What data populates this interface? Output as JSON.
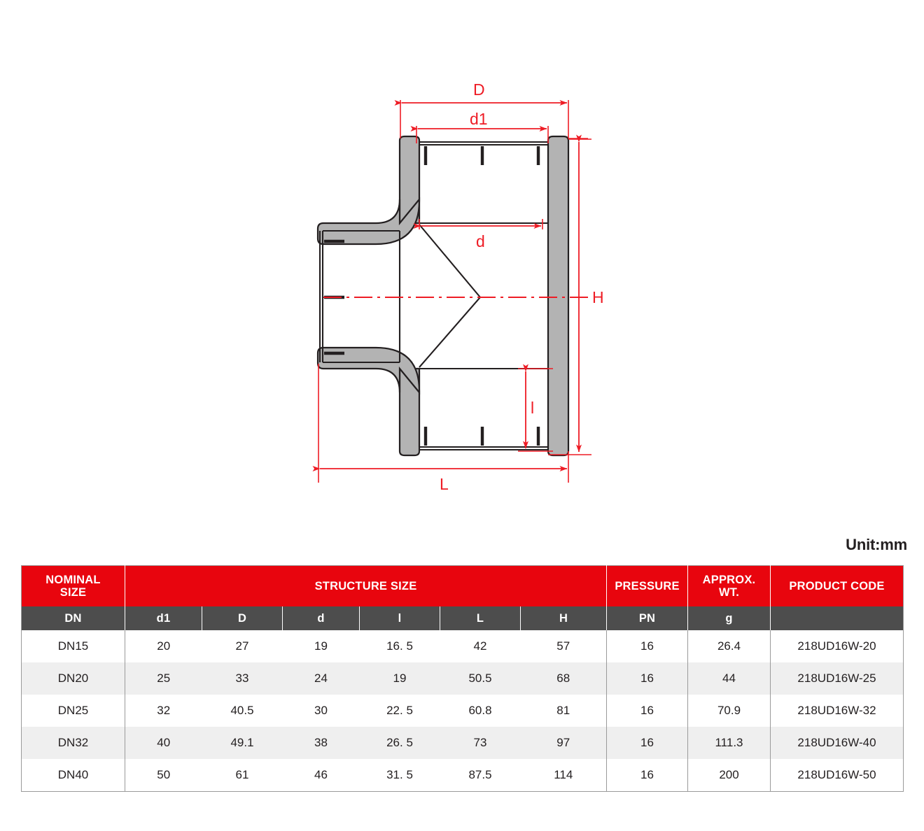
{
  "drawing": {
    "title": "pipe-tee-fitting-cross-section",
    "dimension_labels": {
      "D": "D",
      "d1": "d1",
      "d": "d",
      "H": "H",
      "l": "l",
      "L": "L"
    },
    "colors": {
      "dimension_red": "#ee1c25",
      "body_fill": "#b3b3b3",
      "outline": "#231f20"
    }
  },
  "unit_caption": "Unit:mm",
  "table": {
    "group_headers": [
      {
        "label": "NOMINAL\nSIZE",
        "line1": "NOMINAL",
        "line2": "SIZE"
      },
      {
        "label": "STRUCTURE SIZE"
      },
      {
        "label": "PRESSURE"
      },
      {
        "label": "APPROX.\nWT.",
        "line1": "APPROX.",
        "line2": "WT."
      },
      {
        "label": "PRODUCT CODE"
      }
    ],
    "symbol_headers": [
      "DN",
      "d1",
      "D",
      "d",
      "l",
      "L",
      "H",
      "PN",
      "g",
      ""
    ],
    "rows": [
      {
        "DN": "DN15",
        "d1": "20",
        "D": "27",
        "d": "19",
        "l": "16. 5",
        "L": "42",
        "H": "57",
        "PN": "16",
        "g": "26.4",
        "code": "218UD16W-20"
      },
      {
        "DN": "DN20",
        "d1": "25",
        "D": "33",
        "d": "24",
        "l": "19",
        "L": "50.5",
        "H": "68",
        "PN": "16",
        "g": "44",
        "code": "218UD16W-25"
      },
      {
        "DN": "DN25",
        "d1": "32",
        "D": "40.5",
        "d": "30",
        "l": "22. 5",
        "L": "60.8",
        "H": "81",
        "PN": "16",
        "g": "70.9",
        "code": "218UD16W-32"
      },
      {
        "DN": "DN32",
        "d1": "40",
        "D": "49.1",
        "d": "38",
        "l": "26. 5",
        "L": "73",
        "H": "97",
        "PN": "16",
        "g": "111.3",
        "code": "218UD16W-40"
      },
      {
        "DN": "DN40",
        "d1": "50",
        "D": "61",
        "d": "46",
        "l": "31. 5",
        "L": "87.5",
        "H": "114",
        "PN": "16",
        "g": "200",
        "code": "218UD16W-50"
      }
    ]
  }
}
